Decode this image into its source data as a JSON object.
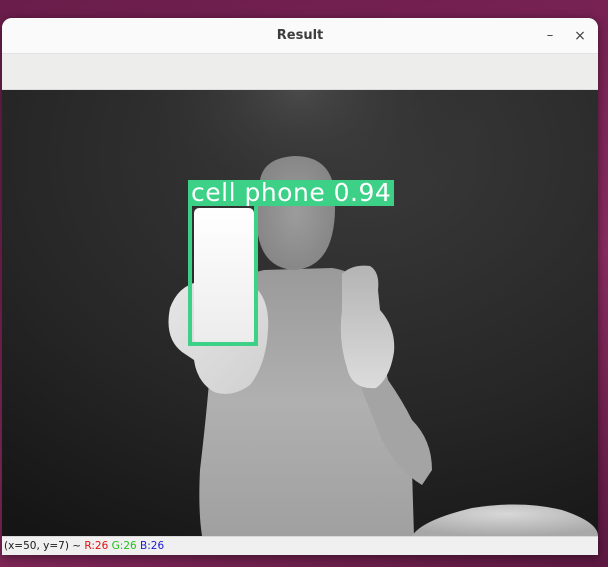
{
  "window": {
    "title": "Result",
    "minimize_icon": "minimize-icon",
    "close_icon": "close-icon",
    "minimize_glyph": "–",
    "close_glyph": "×"
  },
  "detection": {
    "label": "cell phone 0.94",
    "box_color": "#3dd188"
  },
  "status": {
    "coords": "(x=50, y=7) ~",
    "r": "R:26",
    "g": "G:26",
    "b": "B:26"
  }
}
